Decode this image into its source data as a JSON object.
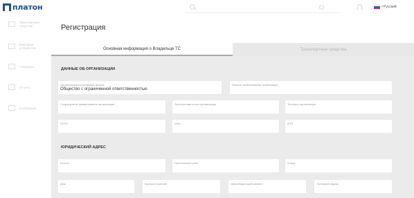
{
  "brand": {
    "logo_text": "платон"
  },
  "topbar": {
    "search_placeholder": "",
    "language": {
      "label": "• Русский",
      "flag_colors": [
        "#ffffff",
        "#1c5bd8",
        "#d32f2f"
      ]
    }
  },
  "sidebar": {
    "items": [
      {
        "label": "Транспортные средства",
        "icon": "truck-icon"
      },
      {
        "label": "Бортовые устройства",
        "icon": "device-icon"
      },
      {
        "label": "Операции",
        "icon": "wallet-icon"
      },
      {
        "label": "Отчеты",
        "icon": "report-icon"
      },
      {
        "label": "Сообщения",
        "icon": "message-icon"
      }
    ]
  },
  "page": {
    "title": "Регистрация",
    "tabs": [
      {
        "label": "Основная информация о Владельце ТС",
        "active": true
      },
      {
        "label": "Транспортные средства",
        "active": false
      }
    ]
  },
  "org_section": {
    "heading": "ДАННЫЕ ОБ ОРГАНИЗАЦИИ",
    "fields": {
      "legal_form": {
        "label": "Организационно-правовая форма",
        "value": "Общество с ограниченной ответственностью"
      },
      "full_name": {
        "label": "Полное наименование организации",
        "value": ""
      },
      "short_name": {
        "label": "Сокращенное наименование организации",
        "value": ""
      },
      "email": {
        "label": "Электронная почта организации",
        "value": ""
      },
      "phone": {
        "label": "Телефон организации",
        "value": ""
      },
      "ogrn": {
        "label": "ОГРН",
        "value": ""
      },
      "inn": {
        "label": "ИНН",
        "value": ""
      },
      "kpp": {
        "label": "КПП",
        "value": ""
      }
    }
  },
  "address_section": {
    "heading": "ЮРИДИЧЕСКИЙ АДРЕС",
    "fields": {
      "region": {
        "label": "Регион",
        "value": ""
      },
      "locality": {
        "label": "Населенный пункт",
        "value": ""
      },
      "street": {
        "label": "Улица",
        "value": ""
      },
      "house": {
        "label": "Дом",
        "value": ""
      },
      "building": {
        "label": "Корпус/Строение",
        "value": ""
      },
      "office": {
        "label": "Офис/Квартира/Комната",
        "value": ""
      },
      "postcode": {
        "label": "Почтовый индекс",
        "value": ""
      }
    }
  }
}
